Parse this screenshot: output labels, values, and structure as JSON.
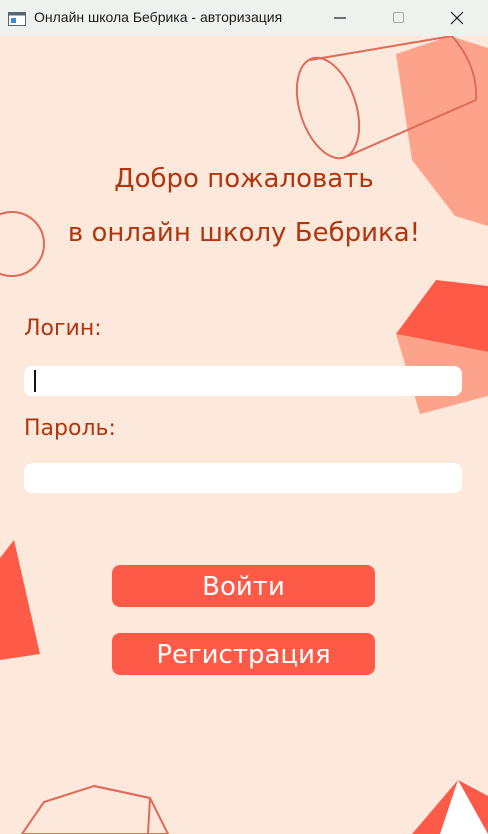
{
  "window": {
    "title": "Онлайн школа Бебрика - авторизация",
    "icon": "app-window-icon",
    "controls": [
      "minimize-icon",
      "maximize-icon",
      "close-icon"
    ]
  },
  "welcome": {
    "line1": "Добро пожаловать",
    "line2": "в онлайн школу Бебрика!"
  },
  "form": {
    "login_label": "Логин:",
    "login_value": "",
    "password_label": "Пароль:",
    "password_value": ""
  },
  "buttons": {
    "login": "Войти",
    "register": "Регистрация"
  },
  "colors": {
    "background": "#fde8dc",
    "accent": "#fd5a48",
    "text": "#b1360f",
    "titlebar": "#eef2ee"
  }
}
